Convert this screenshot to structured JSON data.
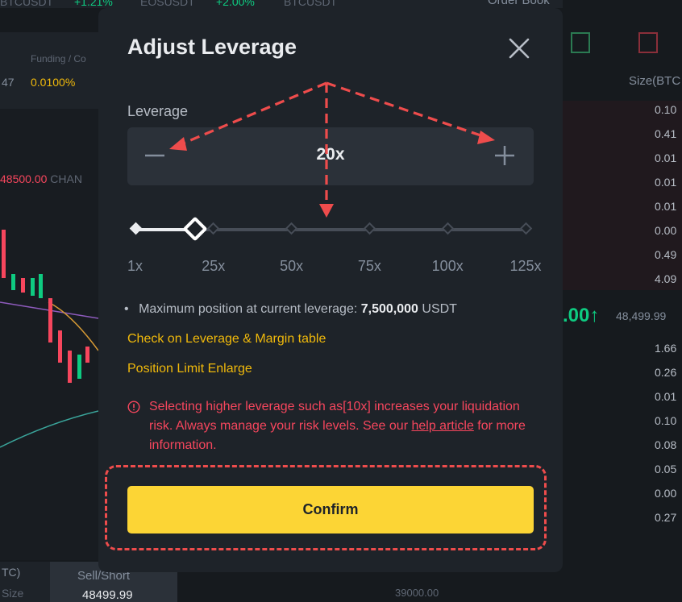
{
  "background": {
    "tickers": [
      {
        "symbol": "BTCUSDT",
        "change": "+1.21%"
      },
      {
        "symbol": "EOSUSDT",
        "change": "+2.00%"
      },
      {
        "symbol": "BTCUSDT",
        "change": ""
      }
    ],
    "funding_label": "Funding / Co",
    "funding_value": "0.0100%",
    "price_fragment": "47",
    "chart_price": "48500.00",
    "chart_change_label": "CHAN",
    "order_book_title": "Order Book",
    "order_book_size_label": "Size(BTC",
    "ask_sizes": [
      "0.10",
      "0.41",
      "0.01",
      "0.01",
      "0.01",
      "0.00",
      "0.49",
      "4.09"
    ],
    "mid_price": ".00",
    "mid_price_arrow": "↑",
    "mark_price": "48,499.99",
    "bid_sizes": [
      "1.66",
      "0.26",
      "0.01",
      "0.10",
      "0.08",
      "0.05",
      "0.00",
      "0.27"
    ],
    "bottom_tc": "TC)",
    "bottom_size": "Size",
    "sell_short_label": "Sell/Short",
    "sell_short_price": "48499.99",
    "axis_value": "39000.00"
  },
  "modal": {
    "title": "Adjust Leverage",
    "close_icon": "close-icon",
    "leverage_label": "Leverage",
    "leverage_value": "20x",
    "minus_icon": "minus-icon",
    "plus_icon": "plus-icon",
    "slider": {
      "value_fraction": 0.153,
      "ticks": [
        "1x",
        "25x",
        "50x",
        "75x",
        "100x",
        "125x"
      ]
    },
    "max_position_label": "Maximum position at current leverage:",
    "max_position_value": "7,500,000",
    "max_position_unit": "USDT",
    "link_leverage_table": "Check on Leverage & Margin table",
    "link_position_limit": "Position Limit Enlarge",
    "warning_icon": "info-circle-icon",
    "warning_text_before": "Selecting higher leverage such as[10x] increases your liquidation risk. Always manage your risk levels. See our",
    "warning_link": "help article",
    "warning_text_after": "for more information.",
    "confirm_label": "Confirm"
  },
  "colors": {
    "accent": "#fcd535",
    "link": "#f0b90b",
    "danger": "#f6465d",
    "annotation": "#ee4c4c",
    "positive": "#0ecb81"
  }
}
